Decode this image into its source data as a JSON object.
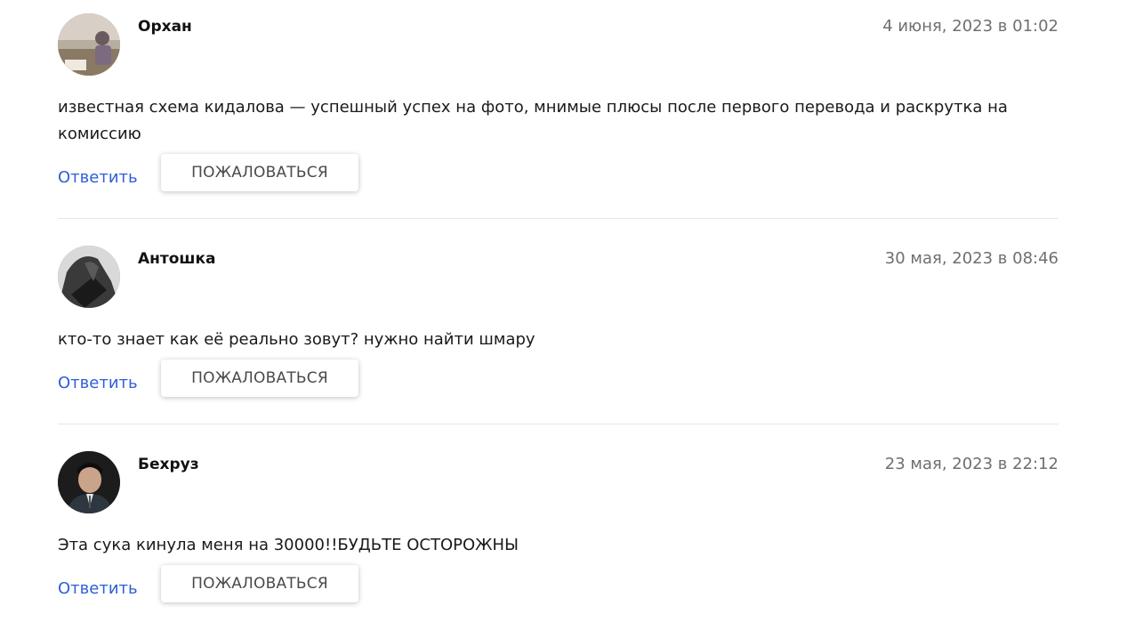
{
  "comments": [
    {
      "author": "Орхан",
      "date": "4 июня, 2023 в 01:02",
      "text": "известная схема кидалова — успешный успех на фото, мнимые плюсы после первого перевода и раскрутка на комиссию",
      "reply_label": "Ответить",
      "report_label": "ПОЖАЛОВАТЬСЯ"
    },
    {
      "author": "Антошка",
      "date": "30 мая, 2023 в 08:46",
      "text": "кто-то знает как её реально зовут? нужно найти шмару",
      "reply_label": "Ответить",
      "report_label": "ПОЖАЛОВАТЬСЯ"
    },
    {
      "author": "Бехруз",
      "date": "23 мая, 2023 в 22:12",
      "text": "Эта сука кинула меня на 30000!!БУДЬТЕ ОСТОРОЖНЫ",
      "reply_label": "Ответить",
      "report_label": "ПОЖАЛОВАТЬСЯ"
    }
  ],
  "colors": {
    "link": "#2d5fd6",
    "date": "#6f6f6f",
    "divider": "#e6e6e6"
  }
}
